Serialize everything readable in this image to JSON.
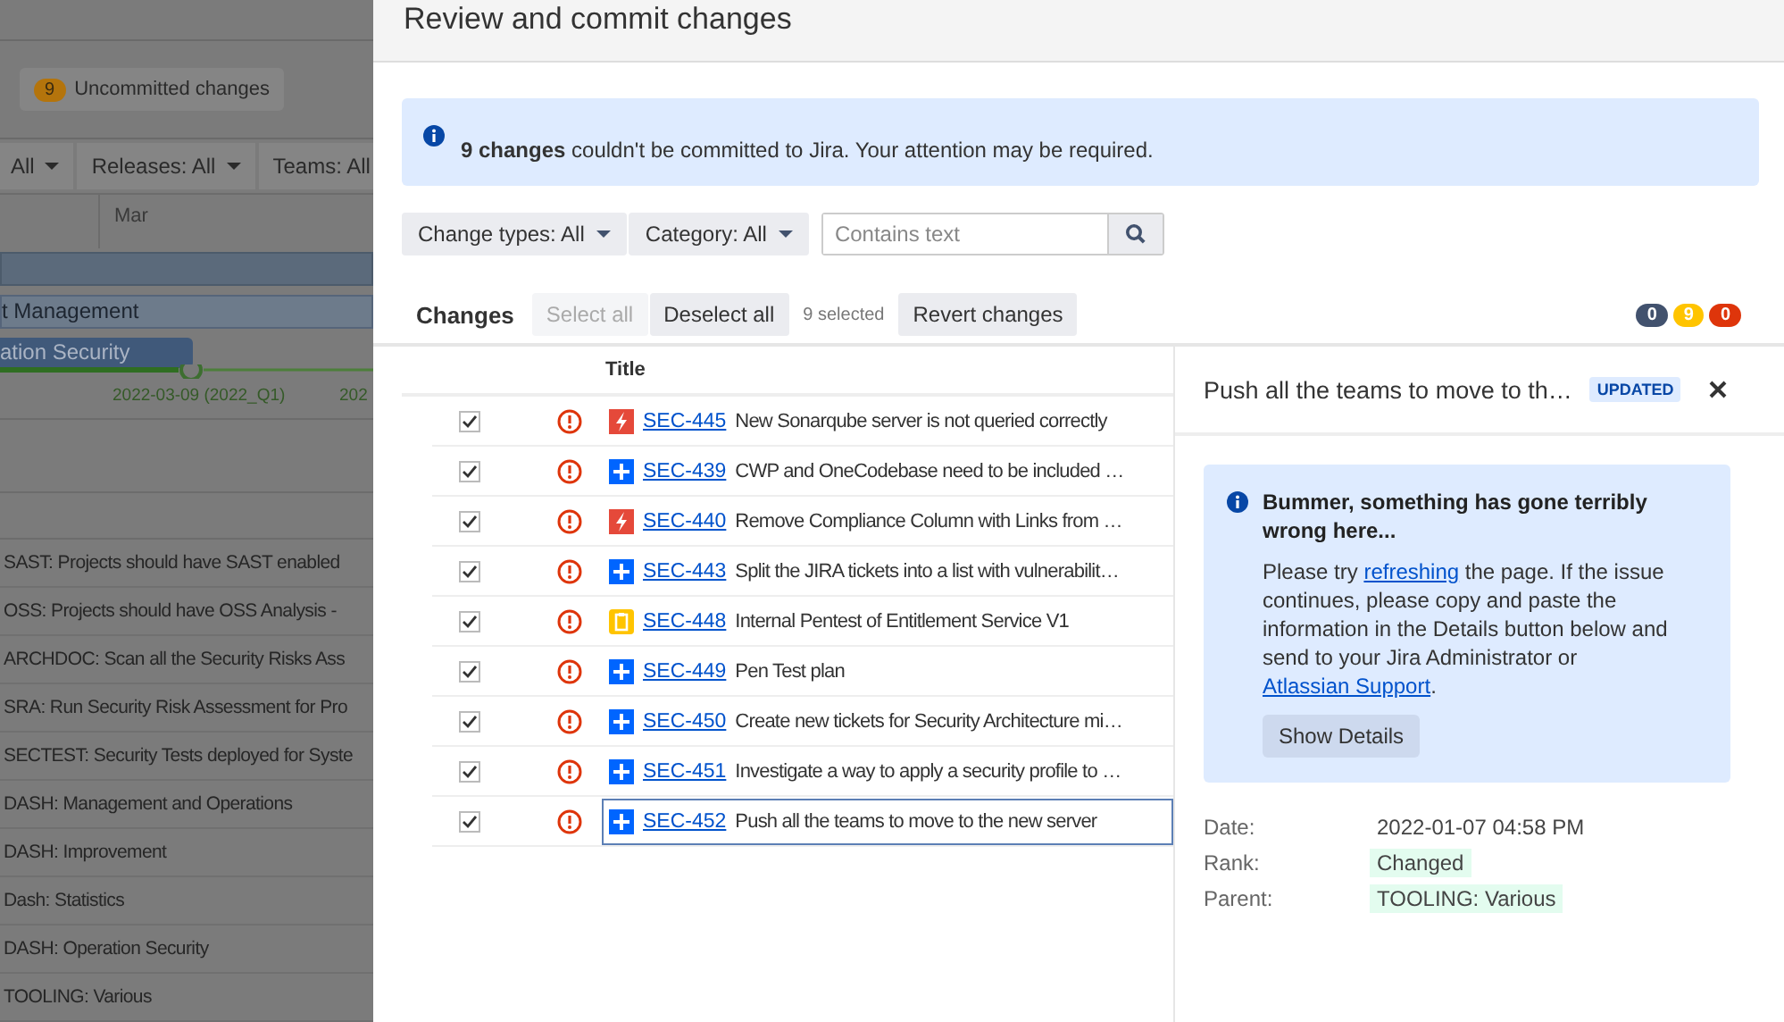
{
  "background": {
    "uncommitted": {
      "count": "9",
      "label": "Uncommitted changes"
    },
    "filters": [
      {
        "label": "All"
      },
      {
        "label": "Releases: All"
      },
      {
        "label": "Teams: All"
      }
    ],
    "month": "Mar",
    "bars": [
      {
        "label": "t Management"
      },
      {
        "label": "ation Security"
      }
    ],
    "dates": [
      "2022-03-09 (2022_Q1)",
      "202"
    ],
    "rows": [
      "SAST: Projects should have SAST enabled",
      "OSS: Projects should have OSS Analysis -",
      "ARCHDOC: Scan all the Security Risks Ass",
      "SRA: Run Security Risk Assessment for Pro",
      "SECTEST: Security Tests deployed for Syste",
      "DASH: Management and Operations",
      "DASH: Improvement",
      "Dash: Statistics",
      "DASH: Operation Security",
      "TOOLING: Various"
    ]
  },
  "modal": {
    "title": "Review and commit changes",
    "banner": "**9 changes** couldn't be committed to Jira. Your attention may be required.",
    "filters": [
      {
        "label": "Change types: All"
      },
      {
        "label": "Category: All"
      }
    ],
    "search": {
      "placeholder": "Contains text"
    },
    "changes": {
      "heading": "Changes",
      "select_all": {
        "label": "Select all",
        "disabled": true
      },
      "deselect_all": {
        "label": "Deselect all",
        "disabled": false
      },
      "selected_count": "9 selected",
      "revert": "Revert changes"
    },
    "counts": [
      {
        "value": "0",
        "color": "#42526e"
      },
      {
        "value": "9",
        "color": "#ffc400"
      },
      {
        "value": "0",
        "color": "#de350b"
      }
    ],
    "table": {
      "column": "Title",
      "rows": [
        {
          "checked": true,
          "kind": "bug",
          "key": "SEC-445",
          "title": "New Sonarqube server is not queried correctly",
          "selected": false
        },
        {
          "checked": true,
          "kind": "story",
          "key": "SEC-439",
          "title": "CWP and OneCodebase need to be included …",
          "selected": false
        },
        {
          "checked": true,
          "kind": "bug",
          "key": "SEC-440",
          "title": "Remove Compliance Column with Links from …",
          "selected": false
        },
        {
          "checked": true,
          "kind": "story",
          "key": "SEC-443",
          "title": "Split the JIRA tickets into a list with vulnerabilit…",
          "selected": false
        },
        {
          "checked": true,
          "kind": "task",
          "key": "SEC-448",
          "title": "Internal Pentest of Entitlement Service V1",
          "selected": false
        },
        {
          "checked": true,
          "kind": "story",
          "key": "SEC-449",
          "title": "Pen Test plan",
          "selected": false
        },
        {
          "checked": true,
          "kind": "story",
          "key": "SEC-450",
          "title": "Create new tickets for Security Architecture mi…",
          "selected": false
        },
        {
          "checked": true,
          "kind": "story",
          "key": "SEC-451",
          "title": "Investigate a way to apply a security profile to …",
          "selected": false
        },
        {
          "checked": true,
          "kind": "story",
          "key": "SEC-452",
          "title": "Push all the teams to move to the new server",
          "selected": true
        }
      ]
    },
    "detail": {
      "title": "Push all the teams to move to th…",
      "lozenge": "UPDATED",
      "error": {
        "heading": "Bummer, something has gone terribly wrong here...",
        "body": [
          {
            "kind": "text",
            "text": "Please try "
          },
          {
            "kind": "link",
            "text": "refreshing"
          },
          {
            "kind": "text",
            "text": " the page. If the issue continues, please copy and paste the information in the Details button below and send to your Jira Administrator or "
          },
          {
            "kind": "link",
            "text": "Atlassian Support"
          },
          {
            "kind": "text",
            "text": "."
          }
        ],
        "button": "Show Details"
      },
      "fields": [
        {
          "label": "Date:",
          "value": "2022-01-07 04:58 PM",
          "highlighted": false
        },
        {
          "label": "Rank:",
          "value": "Changed",
          "highlighted": true
        },
        {
          "label": "Parent:",
          "value": "TOOLING: Various",
          "highlighted": true
        }
      ]
    }
  }
}
